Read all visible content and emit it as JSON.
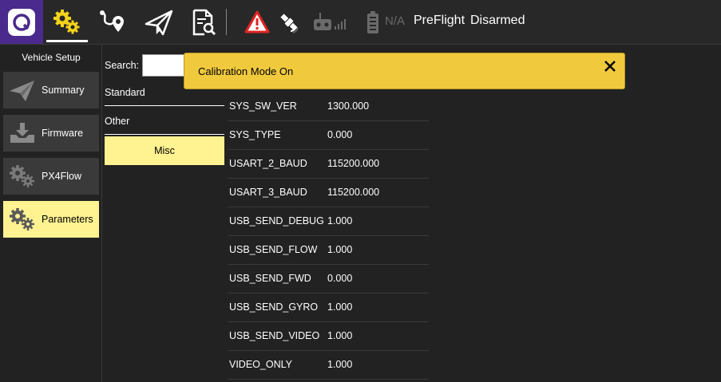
{
  "toolbar": {
    "flight_mode": "PreFlight",
    "arm_state": "Disarmed",
    "battery_label": "N/A",
    "icons": [
      "qgc-logo-icon",
      "gears-icon",
      "plan-route-icon",
      "paper-plane-icon",
      "analyze-document-icon",
      "warning-icon",
      "gps-satellite-icon",
      "rc-signal-icon",
      "battery-icon"
    ],
    "accent_color": "#f5d31a",
    "logo_bg": "#4a2a8c",
    "warning_color": "#e02424"
  },
  "sidebar": {
    "title": "Vehicle Setup",
    "items": [
      {
        "label": "Summary",
        "icon": "paper-plane-icon",
        "active": false
      },
      {
        "label": "Firmware",
        "icon": "download-icon",
        "active": false
      },
      {
        "label": "PX4Flow",
        "icon": "gears-icon",
        "active": false
      },
      {
        "label": "Parameters",
        "icon": "gears-icon",
        "active": true
      }
    ],
    "active_color": "#fff291"
  },
  "groups": {
    "search_label": "Search:",
    "search_value": "",
    "items": [
      {
        "label": "Standard"
      },
      {
        "label": "Other"
      },
      {
        "label": "Misc"
      }
    ]
  },
  "params": {
    "rows": [
      {
        "name": "SYS_SW_VER",
        "value": "1300.000"
      },
      {
        "name": "SYS_TYPE",
        "value": "0.000"
      },
      {
        "name": "USART_2_BAUD",
        "value": "115200.000"
      },
      {
        "name": "USART_3_BAUD",
        "value": "115200.000"
      },
      {
        "name": "USB_SEND_DEBUG",
        "value": "1.000"
      },
      {
        "name": "USB_SEND_FLOW",
        "value": "1.000"
      },
      {
        "name": "USB_SEND_FWD",
        "value": "0.000"
      },
      {
        "name": "USB_SEND_GYRO",
        "value": "1.000"
      },
      {
        "name": "USB_SEND_VIDEO",
        "value": "1.000"
      },
      {
        "name": "VIDEO_ONLY",
        "value": "1.000"
      }
    ]
  },
  "banner": {
    "text": "Calibration Mode On",
    "close_icon": "close-icon",
    "color": "#f0c93d"
  }
}
